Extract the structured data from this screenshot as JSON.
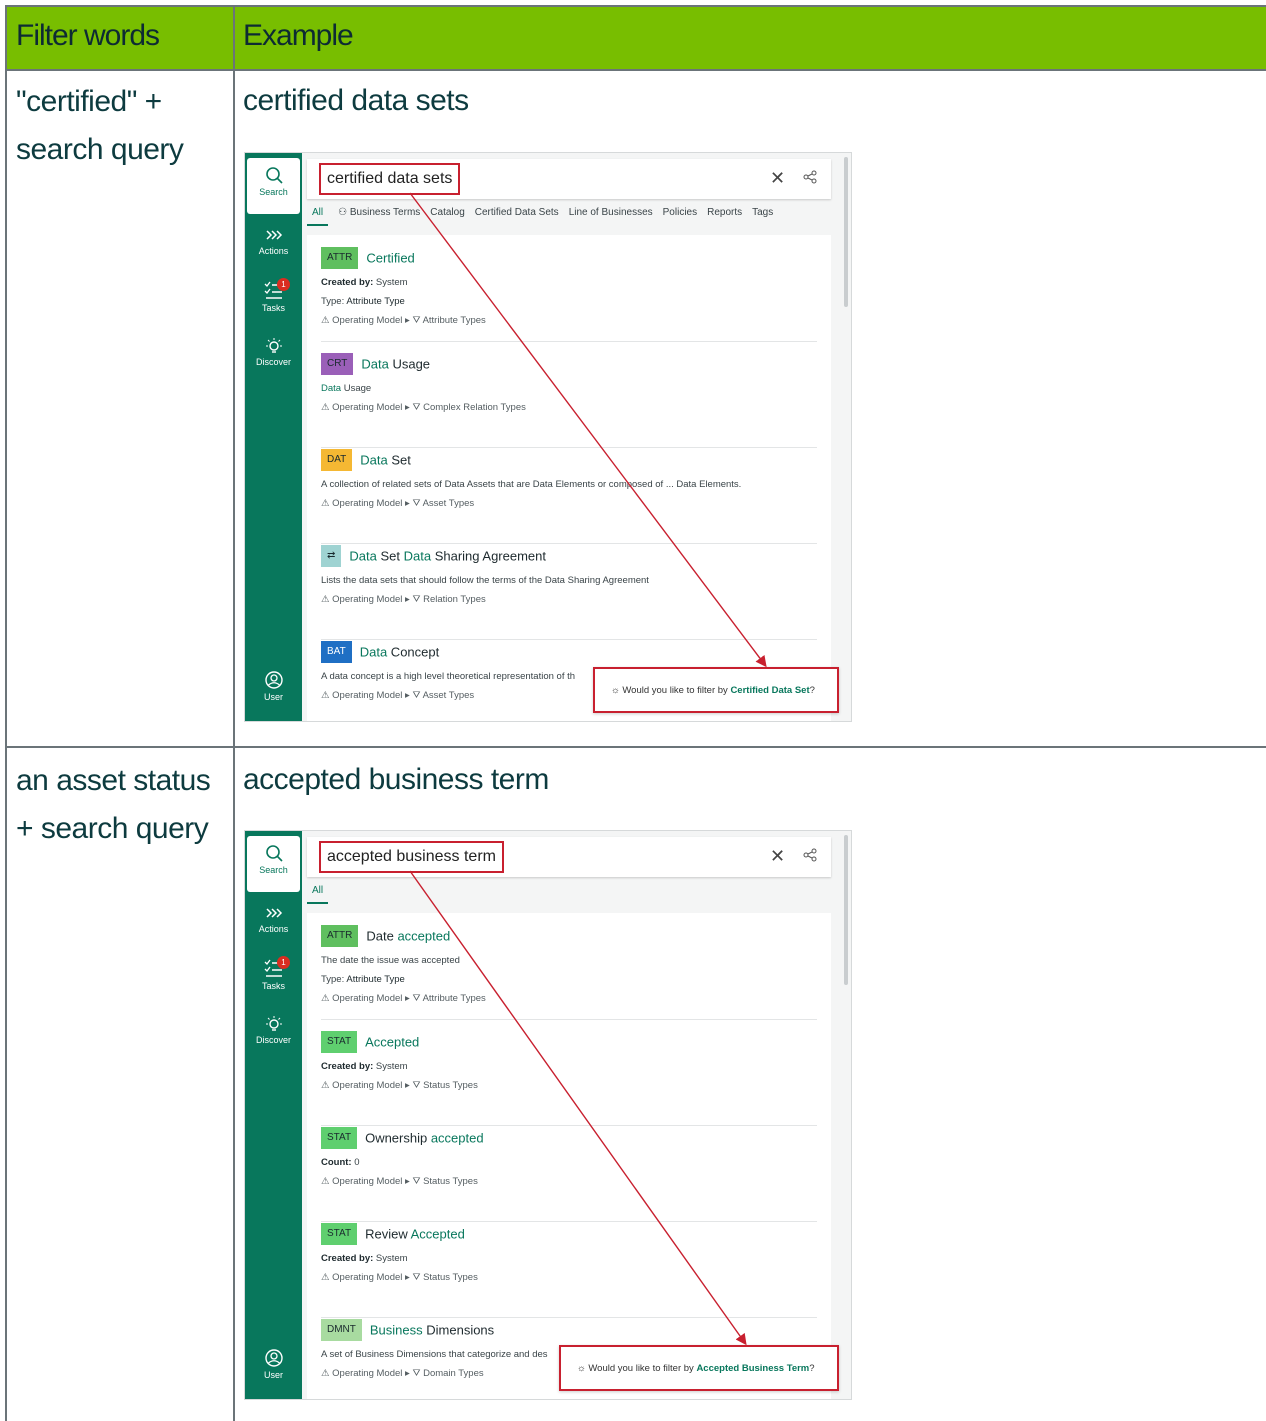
{
  "table": {
    "headers": [
      "Filter words",
      "Example"
    ],
    "rows": [
      {
        "filter_lines": [
          "\"certified\" +",
          "search query"
        ],
        "example_title": "certified data sets",
        "screenshot": {
          "rail": {
            "search": "Search",
            "actions": "Actions",
            "tasks": "Tasks",
            "tasks_badge": "1",
            "discover": "Discover",
            "user": "User"
          },
          "query": "certified data sets",
          "tabs": [
            "All",
            "Business Terms",
            "Catalog",
            "Certified Data Sets",
            "Line of Businesses",
            "Policies",
            "Reports",
            "Tags"
          ],
          "results": [
            {
              "tag": "ATTR",
              "tag_color": "#5fbf5f",
              "title_parts": [
                {
                  "t": "Certified",
                  "hl": true
                }
              ],
              "line1_label": "Created by:",
              "line1_value": " System",
              "line2_label": "Type:",
              "line2_value": "Attribute Type",
              "path_a": "Operating Model",
              "path_b": "Attribute Types"
            },
            {
              "tag": "CRT",
              "tag_color": "#9a5fb8",
              "title_parts": [
                {
                  "t": "Data",
                  "hl": true
                },
                {
                  "t": " Usage",
                  "hl": false
                }
              ],
              "line1_hl": "Data",
              "line1_rest": " Usage",
              "path_a": "Operating Model",
              "path_b": "Complex Relation Types"
            },
            {
              "tag": "DAT",
              "tag_color": "#f5b833",
              "title_parts": [
                {
                  "t": "Data",
                  "hl": true
                },
                {
                  "t": " Set",
                  "hl": false
                }
              ],
              "desc": "A collection of related sets of Data Assets that are Data Elements or composed of ... Data Elements.",
              "path_a": "Operating Model",
              "path_b": "Asset Types"
            },
            {
              "tag": "⇄",
              "tag_color": "#9fd3d2",
              "title_parts": [
                {
                  "t": "Data",
                  "hl": true
                },
                {
                  "t": " Set ",
                  "hl": false
                },
                {
                  "t": "Data",
                  "hl": true
                },
                {
                  "t": " Sharing Agreement",
                  "hl": false
                }
              ],
              "desc": "Lists the data sets that should follow the terms of the Data Sharing Agreement",
              "path_a": "Operating Model",
              "path_b": "Relation Types"
            },
            {
              "tag": "BAT",
              "tag_color": "#1f6fc4",
              "title_parts": [
                {
                  "t": "Data",
                  "hl": true
                },
                {
                  "t": " Concept",
                  "hl": false
                }
              ],
              "desc": "A data concept is a high level theoretical representation of th",
              "path_a": "Operating Model",
              "path_b": "Asset Types"
            }
          ],
          "suggestion_prefix": "Would you like to filter by ",
          "suggestion_link": "Certified Data Set",
          "suggestion_suffix": "?"
        }
      },
      {
        "filter_lines": [
          "an asset status",
          "+ search query"
        ],
        "example_title": "accepted business term",
        "screenshot": {
          "rail": {
            "search": "Search",
            "actions": "Actions",
            "tasks": "Tasks",
            "tasks_badge": "1",
            "discover": "Discover",
            "user": "User"
          },
          "query": "accepted business term",
          "tabs": [
            "All"
          ],
          "results": [
            {
              "tag": "ATTR",
              "tag_color": "#5fbf5f",
              "title_parts": [
                {
                  "t": "Date ",
                  "hl": false
                },
                {
                  "t": "accepted",
                  "hl": true
                }
              ],
              "desc": "The date the issue was accepted",
              "line2_label": "Type:",
              "line2_value": "Attribute Type",
              "path_a": "Operating Model",
              "path_b": "Attribute Types"
            },
            {
              "tag": "STAT",
              "tag_color": "#5fcf6f",
              "title_parts": [
                {
                  "t": "Accepted",
                  "hl": true
                }
              ],
              "line1_label": "Created by:",
              "line1_value": " System",
              "path_a": "Operating Model",
              "path_b": "Status Types"
            },
            {
              "tag": "STAT",
              "tag_color": "#5fcf6f",
              "title_parts": [
                {
                  "t": "Ownership ",
                  "hl": false
                },
                {
                  "t": "accepted",
                  "hl": true
                }
              ],
              "line1_label": "Count:",
              "line1_value": " 0",
              "path_a": "Operating Model",
              "path_b": "Status Types"
            },
            {
              "tag": "STAT",
              "tag_color": "#5fcf6f",
              "title_parts": [
                {
                  "t": "Review ",
                  "hl": false
                },
                {
                  "t": "Accepted",
                  "hl": true
                }
              ],
              "line1_label": "Created by:",
              "line1_value": " System",
              "path_a": "Operating Model",
              "path_b": "Status Types"
            },
            {
              "tag": "DMNT",
              "tag_color": "#a8dba0",
              "title_parts": [
                {
                  "t": "Business",
                  "hl": true
                },
                {
                  "t": " Dimensions",
                  "hl": false
                }
              ],
              "desc": "A set of Business Dimensions that categorize and des",
              "path_a": "Operating Model",
              "path_b": "Domain Types"
            }
          ],
          "suggestion_prefix": "Would you like to filter by ",
          "suggestion_link": "Accepted Business Term",
          "suggestion_suffix": "?"
        }
      }
    ]
  },
  "colors": {
    "header_bg": "#78be00",
    "rail": "#08775c",
    "highlight": "#08775c",
    "callout_border": "#c8202f"
  }
}
